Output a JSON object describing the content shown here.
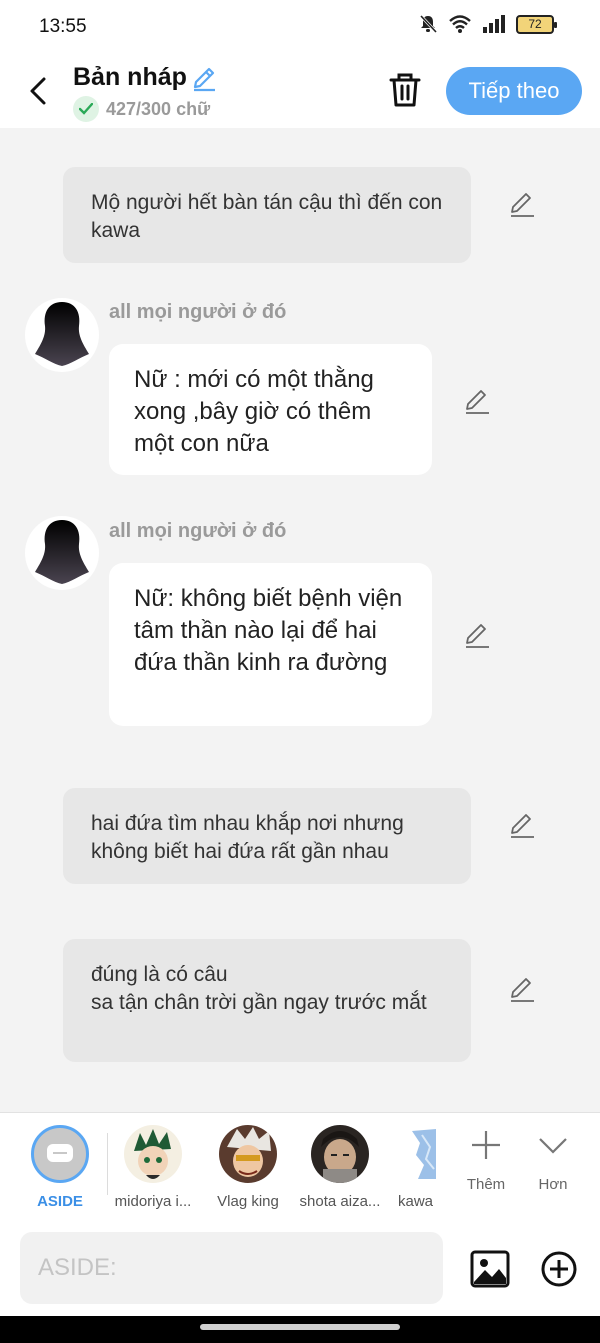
{
  "status": {
    "time": "13:55",
    "battery": "72"
  },
  "header": {
    "title": "Bản nháp",
    "word_count": "427/300 chữ",
    "next_label": "Tiếp theo"
  },
  "messages": [
    {
      "type": "aside",
      "text": "Mộ người hết bàn tán cậu thì đến con kawa"
    },
    {
      "type": "dialogue",
      "speaker": "all mọi người ở đó",
      "text": "Nữ : mới có một thằng xong ,bây giờ có thêm một con nữa"
    },
    {
      "type": "dialogue",
      "speaker": "all mọi người ở đó",
      "text": "Nữ: không biết bệnh viện tâm thần nào lại để hai đứa thần kinh ra đường"
    },
    {
      "type": "aside",
      "text": "hai đứa tìm nhau khắp nơi nhưng không biết hai đứa rất gần nhau"
    },
    {
      "type": "aside",
      "text": "đúng là có câu\nsa tận chân trời gần ngay trước mắt"
    }
  ],
  "characters": [
    {
      "label": "ASIDE",
      "icon": "chat-bubble-icon"
    },
    {
      "label": "midoriya i...",
      "color": "#2e6b3a"
    },
    {
      "label": "Vlag king",
      "color": "#c9c4c0"
    },
    {
      "label": "shota aiza...",
      "color": "#3c3a38"
    },
    {
      "label": "kawa",
      "color": "#7ba7d6"
    }
  ],
  "tools": {
    "more_label": "Thêm",
    "expand_label": "Hơn"
  },
  "composer": {
    "placeholder": "ASIDE:"
  },
  "colors": {
    "accent": "#5aa7f3",
    "aside_bubble": "#e7e7e7",
    "background": "#f3f3f3"
  }
}
